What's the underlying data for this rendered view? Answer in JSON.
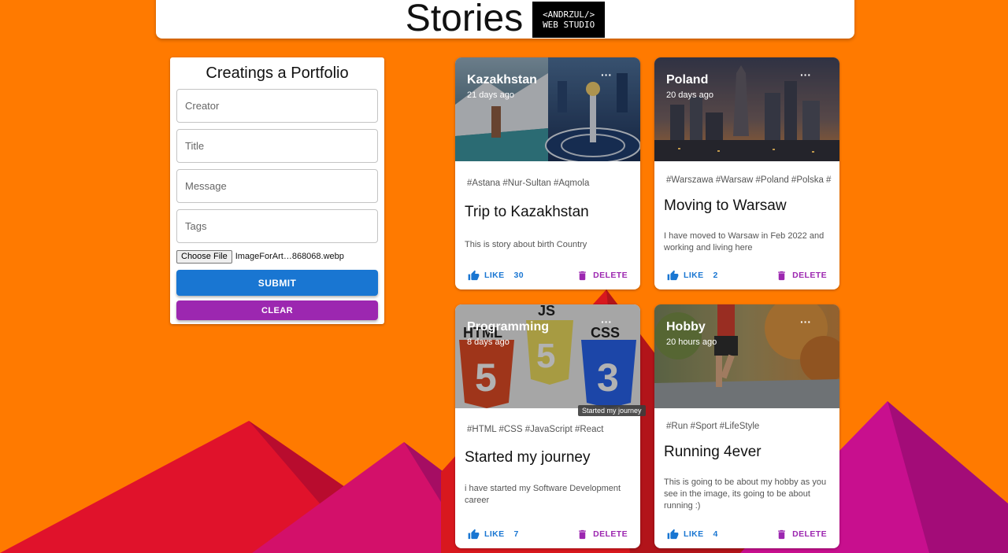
{
  "header": {
    "title": "Stories",
    "logo_line1": "<ANDRZUL/>",
    "logo_line2": "WEB STUDIO"
  },
  "form": {
    "title": "Creatings a Portfolio",
    "creator_placeholder": "Creator",
    "title_placeholder": "Title",
    "message_placeholder": "Message",
    "tags_placeholder": "Tags",
    "choose_file_label": "Choose File",
    "file_name": "ImageForArt…868068.webp",
    "submit_label": "SUBMIT",
    "clear_label": "CLEAR"
  },
  "actions": {
    "like_label": "LIKE",
    "delete_label": "DELETE"
  },
  "posts": [
    {
      "country": "Kazakhstan",
      "time": "21 days ago",
      "more": "···",
      "tags": "#Astana #Nur-Sultan #Aqmola",
      "title": "Trip to Kazakhstan",
      "message": "This is story about birth Country",
      "likes": "30"
    },
    {
      "country": "Poland",
      "time": "20 days ago",
      "more": "···",
      "tags": "#Warszawa #Warsaw #Poland #Polska #",
      "title": "Moving to Warsaw",
      "message": "I have moved to Warsaw in Feb 2022 and working and living here",
      "likes": "2"
    },
    {
      "country": "Programming",
      "time": "8 days ago",
      "more": "···",
      "tags": "#HTML #CSS #JavaScript #React",
      "title": "Started my journey",
      "message": "i have started my Software Development career",
      "likes": "7"
    },
    {
      "country": "Hobby",
      "time": "20 hours ago",
      "more": "···",
      "tags": "#Run #Sport #LifeStyle",
      "title": "Running 4ever",
      "message": "This is going to be about my hobby as you see in the image, its going to be about running :)",
      "likes": "4"
    }
  ],
  "tooltip": "Started my journey",
  "image_labels": {
    "js": "JS",
    "html": "HTML",
    "css": "CSS",
    "html5": "5",
    "js5": "5",
    "css3": "3"
  },
  "colors": {
    "background": "#ff7a00",
    "primary": "#1976d2",
    "secondary": "#9c27b0"
  }
}
